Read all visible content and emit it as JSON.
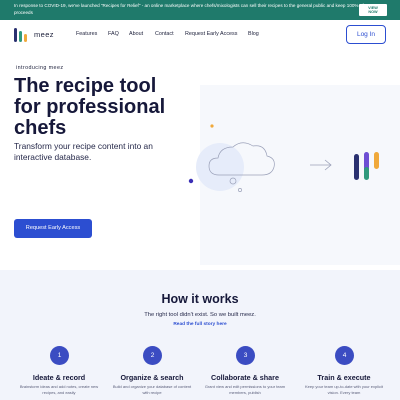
{
  "banner": {
    "text": "In response to COVID-19, we've launched \"Recipes for Relief\" - an online marketplace where chefs/mixologists can sell their recipes to the general public and keep 100% of proceeds",
    "button_line1": "VIEW",
    "button_line2": "NOW"
  },
  "nav": {
    "logo_text": "meez",
    "links": [
      "Features",
      "FAQ",
      "About",
      "Contact",
      "Request Early Access",
      "Blog"
    ],
    "login": "Log In"
  },
  "hero": {
    "intro": "introducing meez",
    "headline_lines": [
      "The recipe tool",
      "for professional",
      "chefs"
    ],
    "subtitle": "Transform your recipe content into an interactive database.",
    "cta": "Request Early Access"
  },
  "how": {
    "title": "How it works",
    "subtitle": "The right tool didn't exist. So we built meez.",
    "link": "Read the full story here",
    "steps": [
      {
        "num": "1",
        "title": "Ideate & record",
        "desc": "Brainstorm ideas and add notes, create new recipes, and easily"
      },
      {
        "num": "2",
        "title": "Organize & search",
        "desc": "Build and organize your database of content with recipe"
      },
      {
        "num": "3",
        "title": "Collaborate & share",
        "desc": "Grant view and edit permissions to your team members, publish"
      },
      {
        "num": "4",
        "title": "Train & execute",
        "desc": "Keep your team up-to-date with your explicit vision. Every team"
      }
    ]
  },
  "colors": {
    "banner": "#1f7a6b",
    "primary": "#2c4ed1",
    "logo_navy": "#2a3170",
    "logo_green": "#2f9a7d",
    "logo_orange": "#f0a93b",
    "logo_purple": "#6e4fd4"
  },
  "icons": [
    "meez-logo-icon",
    "cloud-icon",
    "arrow-right-icon"
  ]
}
